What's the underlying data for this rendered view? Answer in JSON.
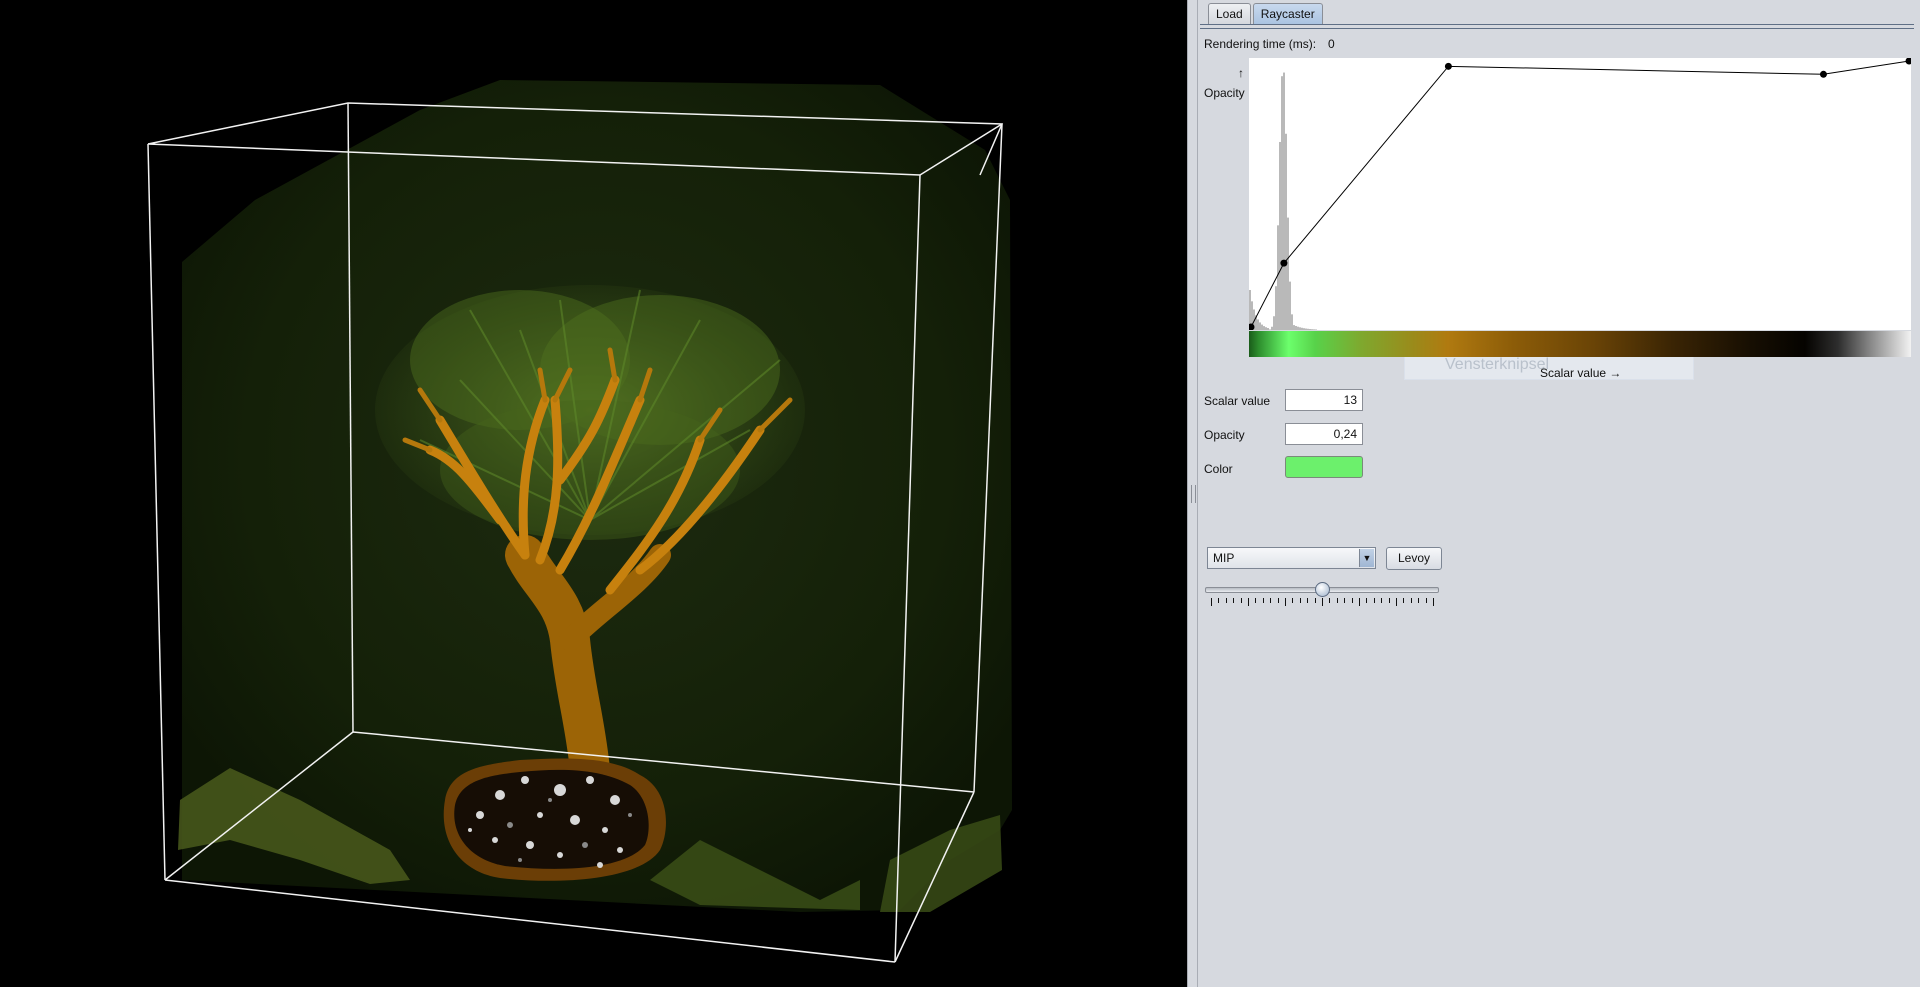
{
  "tabs": [
    {
      "label": "Load",
      "active": false
    },
    {
      "label": "Raycaster",
      "active": true
    }
  ],
  "rendering_time": {
    "label": "Rendering time (ms):",
    "value": "0"
  },
  "transfer_function": {
    "y_axis": {
      "arrow": "↑",
      "label": "Opacity"
    },
    "x_axis_label": "Scalar value →",
    "colormap": [
      "#1a5c1a",
      "#6cff6c",
      "#b07a10",
      "#3a2404",
      "#050300",
      "#f2f2f2"
    ],
    "control_points": [
      {
        "scalar_fraction": 0.0,
        "opacity": 0.0
      },
      {
        "scalar_fraction": 0.05,
        "opacity": 0.24
      },
      {
        "scalar_fraction": 0.3,
        "opacity": 0.98
      },
      {
        "scalar_fraction": 0.87,
        "opacity": 0.95
      },
      {
        "scalar_fraction": 1.0,
        "opacity": 1.0
      }
    ],
    "histogram_peak_fraction": 0.05
  },
  "watermark": "Vensterknipsel",
  "selected_point": {
    "scalar_label": "Scalar value",
    "scalar_value": "13",
    "opacity_label": "Opacity",
    "opacity_value": "0,24",
    "color_label": "Color",
    "color": "#6cf06c"
  },
  "render_mode": {
    "selected": "MIP",
    "arrow": "▼"
  },
  "levoy_button": "Levoy",
  "slider": {
    "value_fraction": 0.5,
    "tick_count": 30
  }
}
